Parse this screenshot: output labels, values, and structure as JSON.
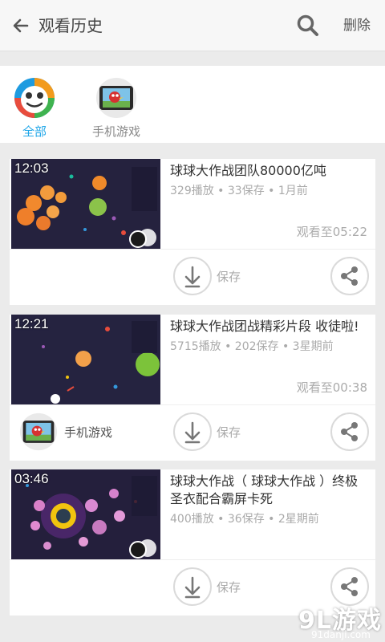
{
  "header": {
    "title": "观看历史",
    "delete_label": "删除",
    "back_icon": "back-arrow-icon",
    "search_icon": "search-icon"
  },
  "categories": [
    {
      "label": "全部",
      "selected": true,
      "icon": "frog-face-icon"
    },
    {
      "label": "手机游戏",
      "selected": false,
      "icon": "tablet-game-icon"
    }
  ],
  "videos": [
    {
      "duration": "12:03",
      "title": "球球大作战团队80000亿吨",
      "meta": "329播放 • 33保存 • 1月前",
      "watched": "观看至05:22",
      "save_label": "保存",
      "tag": ""
    },
    {
      "duration": "12:21",
      "title": "球球大作战团战精彩片段 收徒啦!",
      "meta": "5715播放 • 202保存 • 3星期前",
      "watched": "观看至00:38",
      "save_label": "保存",
      "tag": "手机游戏"
    },
    {
      "duration": "03:46",
      "title": "球球大作战（ 球球大作战 ）终极圣衣配合霸屏卡死",
      "meta": "400播放 • 36保存 • 2星期前",
      "watched": "",
      "save_label": "保存",
      "tag": ""
    }
  ],
  "watermark": {
    "text": "9L游戏",
    "url": "91danji.com"
  },
  "colors": {
    "accent": "#21a7e8",
    "header_bg": "#f7f7f7",
    "page_bg": "#ebebeb"
  }
}
